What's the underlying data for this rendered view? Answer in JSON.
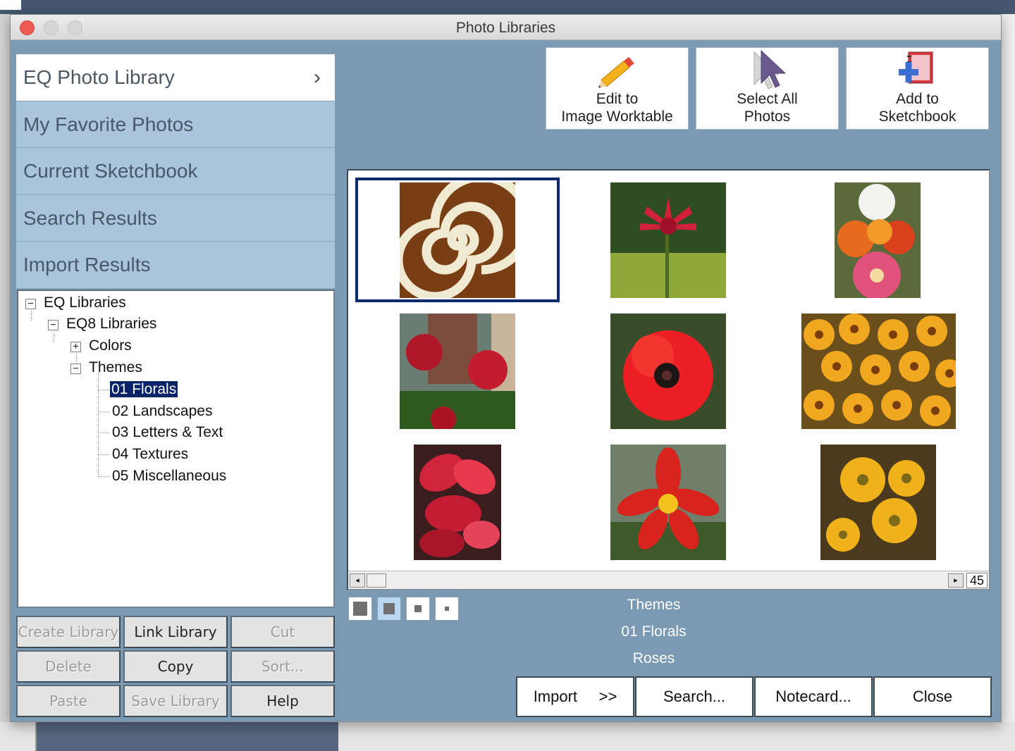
{
  "window": {
    "title": "Photo Libraries"
  },
  "nav": [
    {
      "label": "EQ Photo Library",
      "active": true
    },
    {
      "label": "My Favorite Photos"
    },
    {
      "label": "Current Sketchbook"
    },
    {
      "label": "Search Results"
    },
    {
      "label": "Import Results"
    }
  ],
  "nav_chevron": "›",
  "tree": {
    "root": "EQ Libraries",
    "lib": "EQ8 Libraries",
    "colors": "Colors",
    "themes": "Themes",
    "items": [
      "01 Florals",
      "02 Landscapes",
      "03 Letters & Text",
      "04 Textures",
      "05 Miscellaneous"
    ],
    "selected": "01 Florals",
    "expand_plus": "+",
    "collapse_minus": "−"
  },
  "left_buttons": {
    "create_library": "Create Library",
    "link_library": "Link Library",
    "cut": "Cut",
    "delete": "Delete",
    "copy": "Copy",
    "sort": "Sort...",
    "paste": "Paste",
    "save_library": "Save Library",
    "help": "Help"
  },
  "actions": {
    "edit_line1": "Edit to",
    "edit_line2": "Image Worktable",
    "select_line1": "Select All",
    "select_line2": "Photos",
    "add_line1": "Add to",
    "add_line2": "Sketchbook"
  },
  "grid": {
    "total_count": "45",
    "scroll_left": "◂",
    "scroll_right": "▸"
  },
  "info": {
    "category": "Themes",
    "library": "01 Florals",
    "selected_photo": "Roses"
  },
  "bottom_buttons": {
    "import": "Import",
    "import_arrows": ">>",
    "search": "Search...",
    "notecard": "Notecard...",
    "close": "Close"
  },
  "colors": {
    "dialog_bg": "#7a9ab3",
    "nav_bg": "#a9c4db",
    "selection": "#0a246a"
  }
}
